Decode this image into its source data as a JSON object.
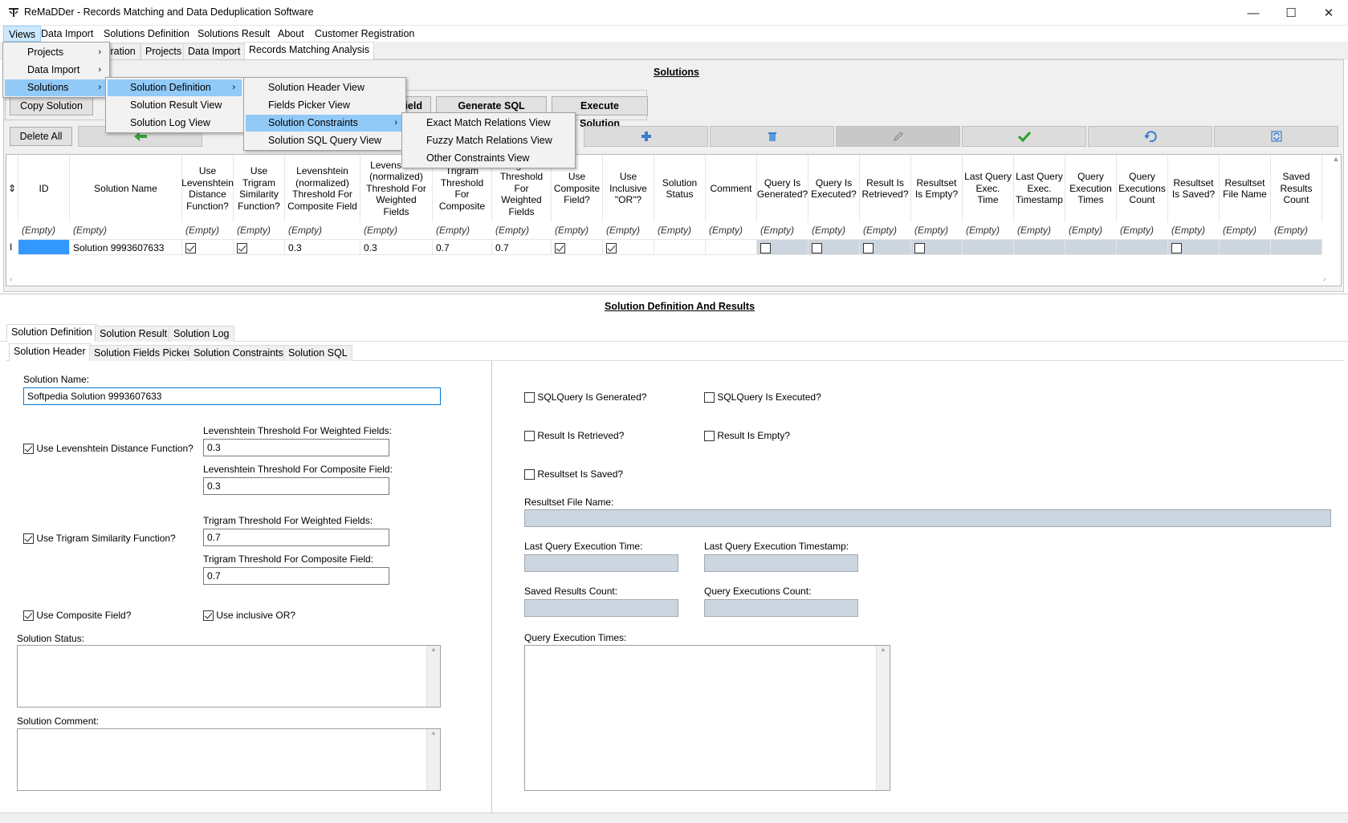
{
  "window": {
    "title": "ReMaDDer - Records Matching and Data Deduplication Software",
    "minimize": "—",
    "maximize": "☐",
    "close": "✕"
  },
  "menubar": [
    "Views",
    "Data Import",
    "Solutions Definition",
    "Solutions Result",
    "About",
    "Customer Registration"
  ],
  "top_tabs": [
    "tration",
    "Projects",
    "Data Import",
    "Records Matching Analysis"
  ],
  "solutions": {
    "header": "Solutions",
    "buttons": {
      "copy": "Copy Solution",
      "field": "ield",
      "gen_sql": "Generate SQL Query",
      "exec": "Execute Solution",
      "delete_all": "Delete All"
    },
    "columns": [
      "ID",
      "Solution Name",
      "Use Levenshtein Distance Function?",
      "Use Trigram Similarity Function?",
      "Levenshtein (normalized) Threshold For Composite Field",
      "Levenshtein (normalized) Threshold For Weighted Fields",
      "Trigram Threshold For Composite",
      "Trigram Threshold For Weighted Fields",
      "Use Composite Field?",
      "Use Inclusive \"OR\"?",
      "Solution Status",
      "Comment",
      "Query Is Generated?",
      "Query Is Executed?",
      "Result Is Retrieved?",
      "Resultset Is Empty?",
      "Last Query Exec. Time",
      "Last Query Exec. Timestamp",
      "Query Execution Times",
      "Query Executions Count",
      "Resultset Is Saved?",
      "Resultset File Name",
      "Saved Results Count"
    ],
    "filter_text": "(Empty)",
    "row": {
      "name": "Solution 9993607633",
      "lev_comp": "0.3",
      "lev_w": "0.3",
      "tri_comp": "0.7",
      "tri_w": "0.7"
    }
  },
  "defs": {
    "header": "Solution Definition And Results",
    "tabs_outer": [
      "Solution Definition",
      "Solution Result",
      "Solution Log"
    ],
    "tabs_inner": [
      "Solution Header",
      "Solution Fields Picker",
      "Solution Constraints",
      "Solution SQL"
    ],
    "name_label": "Solution Name:",
    "name_value": "Softpedia Solution 9993607633",
    "use_lev": "Use Levenshtein Distance Function?",
    "lev_w_label": "Levenshtein Threshold For Weighted Fields:",
    "lev_w_value": "0.3",
    "lev_c_label": "Levenshtein Threshold For Composite Field:",
    "lev_c_value": "0.3",
    "use_tri": "Use Trigram Similarity Function?",
    "tri_w_label": "Trigram Threshold For Weighted Fields:",
    "tri_w_value": "0.7",
    "tri_c_label": "Trigram Threshold For Composite Field:",
    "tri_c_value": "0.7",
    "use_comp": "Use Composite Field?",
    "use_or": "Use inclusive OR?",
    "status_label": "Solution Status:",
    "comment_label": "Solution Comment:",
    "sql_gen": "SQLQuery Is Generated?",
    "sql_exec": "SQLQuery Is Executed?",
    "res_ret": "Result Is Retrieved?",
    "res_empty": "Result Is Empty?",
    "rs_saved": "Resultset Is Saved?",
    "rs_file": "Resultset File Name:",
    "last_time": "Last Query Execution Time:",
    "last_ts": "Last Query Execution Timestamp:",
    "saved_count": "Saved Results Count:",
    "exec_count": "Query Executions Count:",
    "exec_times": "Query Execution Times:"
  },
  "menus": {
    "views": [
      "Projects",
      "Data Import",
      "Solutions"
    ],
    "solutions": [
      "Solution Definition",
      "Solution Result View",
      "Solution Log View"
    ],
    "definition": [
      "Solution Header View",
      "Fields Picker View",
      "Solution Constraints",
      "Solution SQL Query View"
    ],
    "constraints": [
      "Exact Match Relations View",
      "Fuzzy Match Relations View",
      "Other Constraints View"
    ]
  }
}
